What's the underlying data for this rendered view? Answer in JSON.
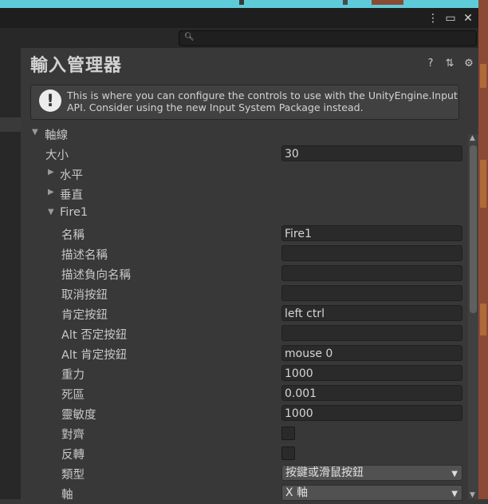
{
  "window": {
    "menu_icon": "kebab-menu-icon",
    "maximize_icon": "maximize-icon",
    "close_icon": "close-icon"
  },
  "search": {
    "placeholder": "",
    "icon": "search-icon"
  },
  "inspector": {
    "title": "輸入管理器",
    "tools": [
      "help-icon",
      "preset-icon",
      "settings-icon"
    ],
    "help_message": "This is where you can configure the controls to use with the UnityEngine.Input API. Consider using the new Input System Package instead."
  },
  "axes": {
    "label": "軸線",
    "size_label": "大小",
    "size_value": "30",
    "groups": [
      {
        "label": "水平",
        "expanded": false
      },
      {
        "label": "垂直",
        "expanded": false
      },
      {
        "label": "Fire1",
        "expanded": true
      }
    ],
    "fire1": {
      "name_label": "名稱",
      "name_value": "Fire1",
      "desc_label": "描述名稱",
      "desc_value": "",
      "neg_desc_label": "描述負向名稱",
      "neg_desc_value": "",
      "neg_button_label": "取消按鈕",
      "neg_button_value": "",
      "pos_button_label": "肯定按鈕",
      "pos_button_value": "left ctrl",
      "alt_neg_label": "Alt 否定按鈕",
      "alt_neg_value": "",
      "alt_pos_label": "Alt 肯定按鈕",
      "alt_pos_value": "mouse 0",
      "gravity_label": "重力",
      "gravity_value": "1000",
      "dead_label": "死區",
      "dead_value": "0.001",
      "sensitivity_label": "靈敏度",
      "sensitivity_value": "1000",
      "snap_label": "對齊",
      "snap_checked": false,
      "invert_label": "反轉",
      "invert_checked": false,
      "type_label": "類型",
      "type_value": "按鍵或滑鼠按鈕",
      "axis_label": "軸",
      "axis_value": "X 軸"
    }
  },
  "colors": {
    "background": "#383838",
    "field": "#2a2a2a",
    "titlebar": "#1e1e1e"
  }
}
